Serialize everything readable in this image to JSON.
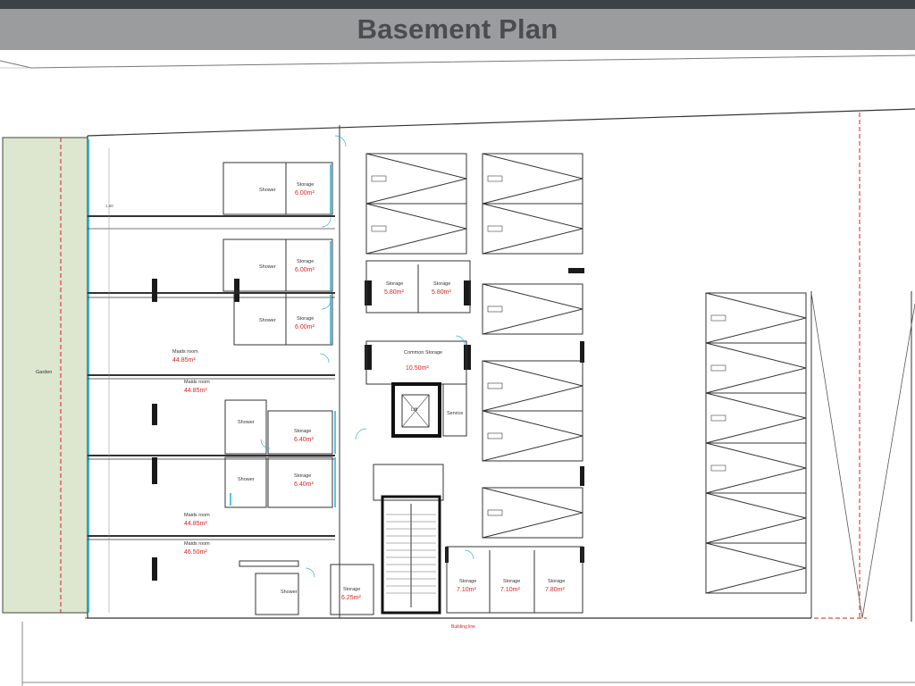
{
  "title": "Basement Plan",
  "labels": {
    "building_line": "Building line",
    "garden": "Garden",
    "lift": "Lift",
    "service": "Service"
  },
  "rooms": {
    "storage_1": {
      "name": "Storage",
      "area": "6.00m²"
    },
    "storage_2": {
      "name": "Storage",
      "area": "6.00m²"
    },
    "storage_3": {
      "name": "Storage",
      "area": "6.00m²"
    },
    "shower_1": "Shower",
    "shower_2": "Shower",
    "shower_3": "Shower",
    "shower_4": "Shower",
    "shower_5": "Shower",
    "shower_6": "Shower",
    "maids_1": {
      "name": "Maids room",
      "area": "44.85m²"
    },
    "maids_2": {
      "name": "Maids room",
      "area": "44.85m²"
    },
    "maids_3": {
      "name": "Maids room",
      "area": "44.85m²"
    },
    "maids_4": {
      "name": "Maids room",
      "area": "46.50m²"
    },
    "storage_4": {
      "name": "Storage",
      "area": "6.40m²"
    },
    "storage_5": {
      "name": "Storage",
      "area": "6.40m²"
    },
    "storage_6": {
      "name": "Storage",
      "area": "6.25m²"
    },
    "storage_7": {
      "name": "Storage",
      "area": "5.80m²"
    },
    "storage_8": {
      "name": "Storage",
      "area": "5.80m²"
    },
    "common_storage": {
      "name": "Common Storage",
      "area": "10.50m²"
    },
    "storage_9": {
      "name": "Storage",
      "area": "7.10m²"
    },
    "storage_10": {
      "name": "Storage",
      "area": "7.10m²"
    },
    "storage_11": {
      "name": "Storage",
      "area": "7.80m²"
    }
  },
  "colors": {
    "garden": "#dde6cf",
    "wall": "#1a1a1a",
    "building_line": "#d22222",
    "glazing": "#2fb5d0"
  }
}
